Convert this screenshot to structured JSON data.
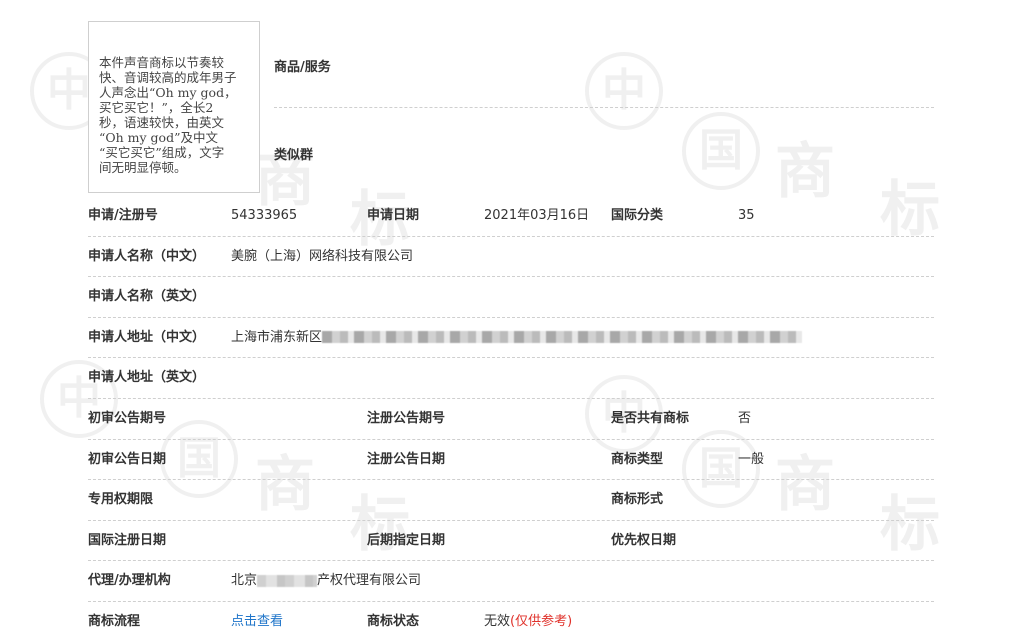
{
  "watermark": {
    "zhong": "中",
    "guo": "国",
    "shang": "商",
    "biao": "标"
  },
  "mark_text": "本件声音商标以节奏较\n快、音调较高的成年男子\n人声念出“Oh my god，\n买它买它！”，全长2\n秒，语速较快，由英文\n“Oh my god”及中文\n“买它买它”组成，文字\n间无明显停顿。",
  "goods_services_label": "商品/服务",
  "similar_group_label": "类似群",
  "fields": {
    "reg_no_label": "申请/注册号",
    "reg_no": "54333965",
    "app_date_label": "申请日期",
    "app_date": "2021年03月16日",
    "intl_class_label": "国际分类",
    "intl_class": "35",
    "applicant_cn_label": "申请人名称（中文）",
    "applicant_cn": "美腕（上海）网络科技有限公司",
    "applicant_en_label": "申请人名称（英文）",
    "address_cn_label": "申请人地址（中文）",
    "address_cn_prefix": "上海市浦东新区",
    "address_en_label": "申请人地址（英文）",
    "prelim_pub_no_label": "初审公告期号",
    "reg_pub_no_label": "注册公告期号",
    "shared_label": "是否共有商标",
    "shared": "否",
    "prelim_pub_date_label": "初审公告日期",
    "reg_pub_date_label": "注册公告日期",
    "tm_type_label": "商标类型",
    "tm_type": "一般",
    "exclusive_period_label": "专用权期限",
    "tm_form_label": "商标形式",
    "intl_reg_date_label": "国际注册日期",
    "later_date_label": "后期指定日期",
    "priority_date_label": "优先权日期",
    "agent_label": "代理/办理机构",
    "agent_prefix": "北京",
    "agent_suffix": "产权代理有限公司",
    "process_label": "商标流程",
    "process_link": "点击查看",
    "status_label": "商标状态",
    "status": "无效",
    "status_note": "(仅供参考)"
  },
  "colors": {
    "link": "#1e74c9",
    "status_note": "#e0322b",
    "separator": "#cfcfcf"
  }
}
